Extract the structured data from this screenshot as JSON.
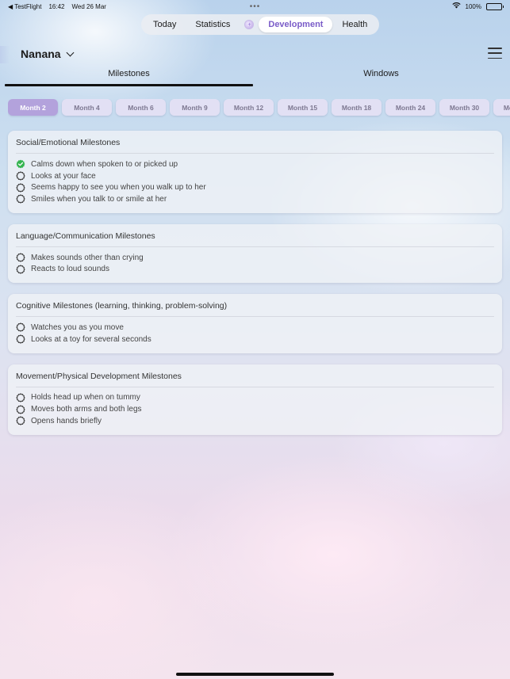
{
  "status_bar": {
    "app": "◀ TestFlight",
    "time": "16:42",
    "date": "Wed 26 Mar",
    "dots": "•••",
    "battery": "100%",
    "icons": [
      "wifi-icon",
      "battery-icon"
    ]
  },
  "top_tabs": [
    {
      "label": "Today",
      "active": false
    },
    {
      "label": "Statistics",
      "active": false
    },
    {
      "label": "+",
      "active": false,
      "icon": "add-entry-icon"
    },
    {
      "label": "Development",
      "active": true
    },
    {
      "label": "Health",
      "active": false
    }
  ],
  "profile": {
    "name": "Nanana",
    "dropdown_icon": "chevron-down-icon",
    "menu_icon": "hamburger-menu-icon"
  },
  "segments": [
    {
      "label": "Milestones",
      "active": true
    },
    {
      "label": "Windows",
      "active": false
    }
  ],
  "months": [
    "Month 2",
    "Month 4",
    "Month 6",
    "Month 9",
    "Month 12",
    "Month 15",
    "Month 18",
    "Month 24",
    "Month 30",
    "Month 36"
  ],
  "active_month": "Month 2",
  "colors": {
    "accent": "#7a5cc8",
    "chip_active": "#b3a2dc",
    "check_green": "#34b450"
  },
  "categories": [
    {
      "title": "Social/Emotional Milestones",
      "items": [
        {
          "text": "Calms down when spoken to or picked up",
          "done": true
        },
        {
          "text": "Looks at your face",
          "done": false
        },
        {
          "text": "Seems happy to see you when you walk up to her",
          "done": false
        },
        {
          "text": "Smiles when you talk to or smile at her",
          "done": false
        }
      ]
    },
    {
      "title": "Language/Communication Milestones",
      "items": [
        {
          "text": "Makes sounds other than crying",
          "done": false
        },
        {
          "text": "Reacts to loud sounds",
          "done": false
        }
      ]
    },
    {
      "title": "Cognitive Milestones (learning, thinking, problem-solving)",
      "items": [
        {
          "text": "Watches you as you move",
          "done": false
        },
        {
          "text": "Looks at a toy for several seconds",
          "done": false
        }
      ]
    },
    {
      "title": "Movement/Physical Development Milestones",
      "items": [
        {
          "text": "Holds head up when on tummy",
          "done": false
        },
        {
          "text": "Moves both arms and both legs",
          "done": false
        },
        {
          "text": "Opens hands briefly",
          "done": false
        }
      ]
    }
  ]
}
